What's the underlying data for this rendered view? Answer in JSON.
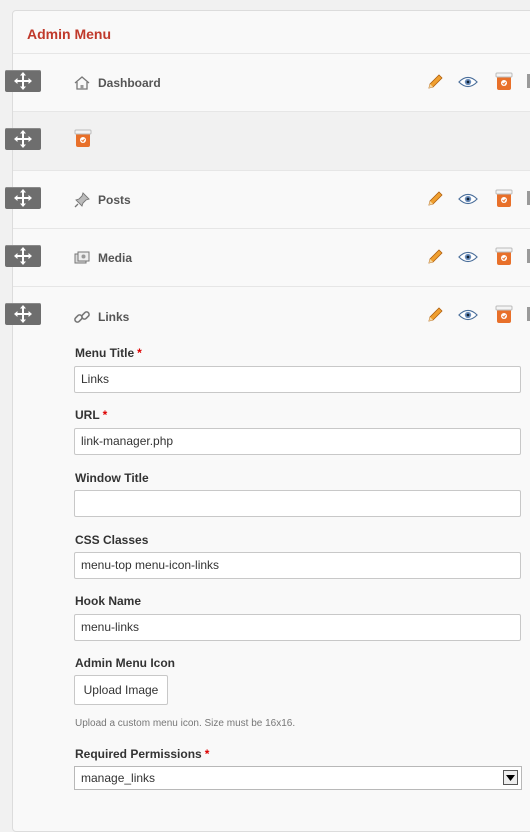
{
  "panel": {
    "title": "Admin Menu"
  },
  "menu_items": [
    {
      "label": "Dashboard",
      "icon": "home-icon"
    },
    {
      "label": "",
      "icon": "trash-icon"
    },
    {
      "label": "Posts",
      "icon": "pushpin-icon"
    },
    {
      "label": "Media",
      "icon": "media-icon"
    },
    {
      "label": "Links",
      "icon": "link-icon"
    }
  ],
  "form": {
    "menu_title": {
      "label": "Menu Title",
      "value": "Links",
      "required": "*"
    },
    "url": {
      "label": "URL",
      "value": "link-manager.php",
      "required": "*"
    },
    "window_title": {
      "label": "Window Title",
      "value": ""
    },
    "css_classes": {
      "label": "CSS Classes",
      "value": "menu-top menu-icon-links"
    },
    "hook_name": {
      "label": "Hook Name",
      "value": "menu-links"
    },
    "admin_menu_icon": {
      "label": "Admin Menu Icon",
      "button": "Upload Image",
      "hint": "Upload a custom menu icon. Size must be 16x16."
    },
    "required_permissions": {
      "label": "Required Permissions",
      "value": "manage_links",
      "required": "*"
    }
  },
  "colors": {
    "title": "#c0392b",
    "handle": "#6e6e6e",
    "pencil": "#f0a030",
    "trash": "#e8702a"
  }
}
